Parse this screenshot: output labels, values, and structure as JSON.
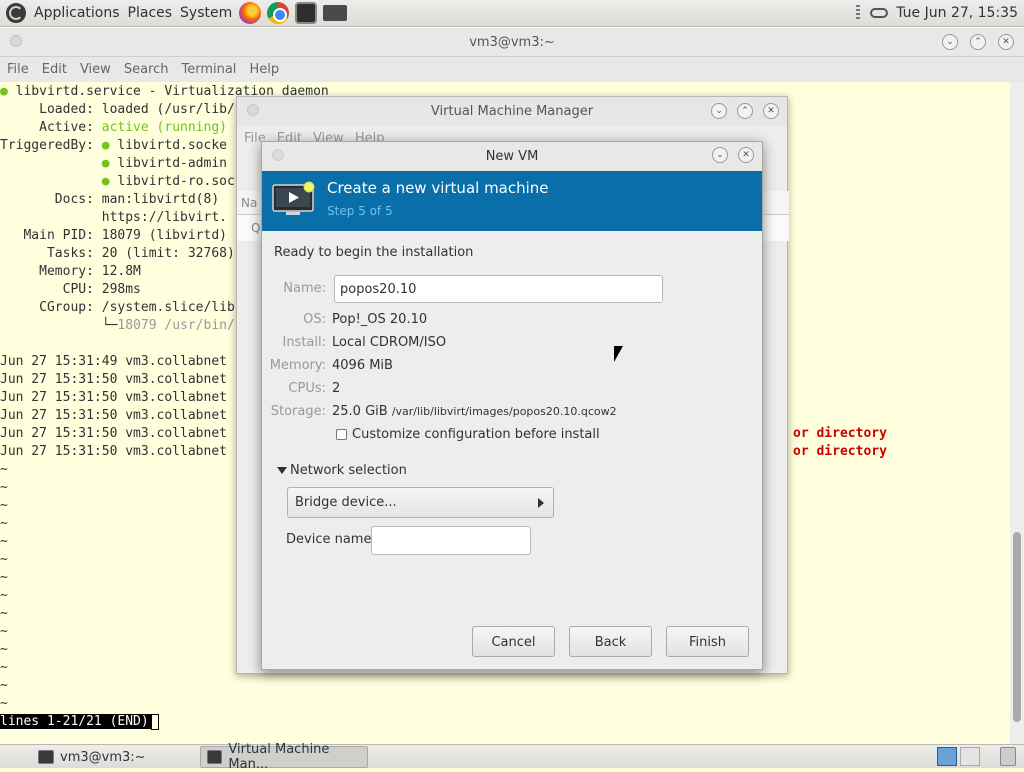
{
  "top_panel": {
    "menus": [
      "Applications",
      "Places",
      "System"
    ],
    "clock": "Tue Jun 27, 15:35"
  },
  "terminal": {
    "title": "vm3@vm3:~",
    "menu": [
      "File",
      "Edit",
      "View",
      "Search",
      "Terminal",
      "Help"
    ],
    "lines": {
      "l1a": "● ",
      "l1b": "libvirtd.service - Virtualization daemon",
      "l2": "     Loaded: loaded (/usr/lib/",
      "l3a": "     Active: ",
      "l3b": "active (running)",
      "l4a": "TriggeredBy: ",
      "l4b": "● ",
      "l4c": "libvirtd.socke",
      "l5a": "             ",
      "l5b": "● ",
      "l5c": "libvirtd-admin",
      "l6a": "             ",
      "l6b": "● ",
      "l6c": "libvirtd-ro.soc",
      "l7": "       Docs: man:libvirtd(8)",
      "l8": "             https://libvirt.",
      "l9": "   Main PID: 18079 (libvirtd)",
      "l10": "      Tasks: 20 (limit: 32768)",
      "l11": "     Memory: 12.8M",
      "l12": "        CPU: 298ms",
      "l13": "     CGroup: /system.slice/lib",
      "l14a": "             └─",
      "l14b": "18079 /usr/bin/",
      "j1": "Jun 27 15:31:49 vm3.collabnet",
      "j2": "Jun 27 15:31:50 vm3.collabnet",
      "j3": "Jun 27 15:31:50 vm3.collabnet",
      "j4": "Jun 27 15:31:50 vm3.collabnet",
      "j5": "Jun 27 15:31:50 vm3.collabnet",
      "j6": "Jun 27 15:31:50 vm3.collabnet",
      "err1": "or directory",
      "err2": "or directory",
      "tilde": "~",
      "status": "lines 1-21/21 (END)"
    }
  },
  "vmm": {
    "title": "Virtual Machine Manager",
    "menu": [
      "File",
      "Edit",
      "View",
      "Help"
    ],
    "list_head": "Na",
    "list_row": "Q"
  },
  "dialog": {
    "title": "New VM",
    "banner_title": "Create a new virtual machine",
    "banner_step": "Step 5 of 5",
    "ready": "Ready to begin the installation",
    "name_label": "Name:",
    "name_value": "popos20.10",
    "os_label": "OS:",
    "os_value": "Pop!_OS 20.10",
    "install_label": "Install:",
    "install_value": "Local CDROM/ISO",
    "memory_label": "Memory:",
    "memory_value": "4096 MiB",
    "cpus_label": "CPUs:",
    "cpus_value": "2",
    "storage_label": "Storage:",
    "storage_value": "25.0 GiB",
    "storage_path": "/var/lib/libvirt/images/popos20.10.qcow2",
    "customize_label": "Customize configuration before install",
    "network_label": "Network selection",
    "bridge_label": "Bridge device...",
    "device_name_label": "Device name:",
    "device_name_value": "",
    "cancel": "Cancel",
    "back": "Back",
    "finish": "Finish"
  },
  "taskbar": {
    "task1": "vm3@vm3:~",
    "task2": "Virtual Machine Man..."
  },
  "colors": {
    "banner": "#0a6ea9",
    "terminal_bg": "#ffffdd",
    "active_green": "#73c41d",
    "error_red": "#cc0000"
  }
}
